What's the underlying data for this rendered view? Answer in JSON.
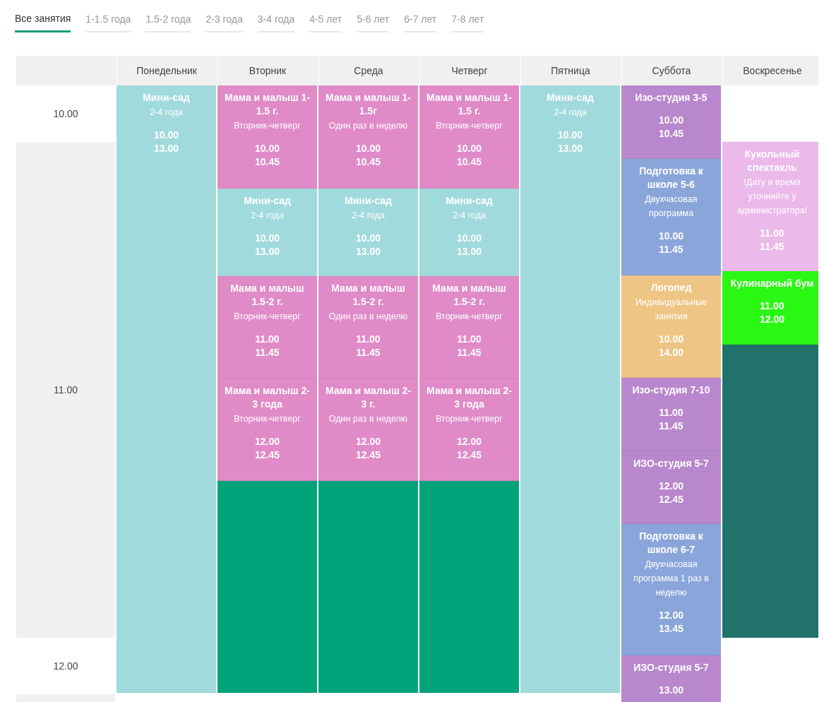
{
  "tabs": [
    {
      "label": "Все занятия",
      "selected": true
    },
    {
      "label": "1-1.5 года",
      "selected": false
    },
    {
      "label": "1.5-2 года",
      "selected": false
    },
    {
      "label": "2-3 года",
      "selected": false
    },
    {
      "label": "3-4 года",
      "selected": false
    },
    {
      "label": "4-5 лет",
      "selected": false
    },
    {
      "label": "5-6 лет",
      "selected": false
    },
    {
      "label": "6-7 лет",
      "selected": false
    },
    {
      "label": "7-8 лет",
      "selected": false
    }
  ],
  "schedule": {
    "time_slots": [
      "10.00",
      "11.00",
      "12.00"
    ],
    "days": [
      {
        "name": "Понедельник",
        "events": [
          {
            "kind": "class",
            "title": "Мини-сад",
            "subtitle": "2-4 года",
            "times": [
              "10.00",
              "13.00"
            ],
            "color": "#a1dadc"
          }
        ]
      },
      {
        "name": "Вторник",
        "events": [
          {
            "kind": "class",
            "title": "Мама и малыш 1-1.5 г.",
            "subtitle": "Вторник-четверг",
            "times": [
              "10.00",
              "10.45"
            ],
            "color": "#e08ac8"
          },
          {
            "kind": "class",
            "title": "Мини-сад",
            "subtitle": "2-4 года",
            "times": [
              "10.00",
              "13.00"
            ],
            "color": "#a1dadc"
          },
          {
            "kind": "class",
            "title": "Мама и малыш 1.5-2 г.",
            "subtitle": "Вторник-четверг",
            "times": [
              "11.00",
              "11.45"
            ],
            "color": "#e08ac8"
          },
          {
            "kind": "class",
            "title": "Мама и малыш 2-3 года",
            "subtitle": "Вторник-четверг",
            "times": [
              "12.00",
              "12.45"
            ],
            "color": "#e08ac8"
          },
          {
            "kind": "filler",
            "color": "#00a37a"
          }
        ]
      },
      {
        "name": "Среда",
        "events": [
          {
            "kind": "class",
            "title": "Мама и малыш 1-1.5г",
            "subtitle": "Один раз в неделю",
            "times": [
              "10.00",
              "10.45"
            ],
            "color": "#e08ac8"
          },
          {
            "kind": "class",
            "title": "Мини-сад",
            "subtitle": "2-4 года",
            "times": [
              "10.00",
              "13.00"
            ],
            "color": "#a1dadc"
          },
          {
            "kind": "class",
            "title": "Мама и малыш 1.5-2 г.",
            "subtitle": "Один раз в неделю",
            "times": [
              "11.00",
              "11.45"
            ],
            "color": "#e08ac8"
          },
          {
            "kind": "class",
            "title": "Мама и малыш 2-3 г.",
            "subtitle": "Один раз в неделю",
            "times": [
              "12.00",
              "12.45"
            ],
            "color": "#e08ac8"
          },
          {
            "kind": "filler",
            "color": "#00a37a"
          }
        ]
      },
      {
        "name": "Четверг",
        "events": [
          {
            "kind": "class",
            "title": "Мама и малыш 1-1.5 г.",
            "subtitle": "Вторник-четверг",
            "times": [
              "10.00",
              "10.45"
            ],
            "color": "#e08ac8"
          },
          {
            "kind": "class",
            "title": "Мини-сад",
            "subtitle": "2-4 года",
            "times": [
              "10.00",
              "13.00"
            ],
            "color": "#a1dadc"
          },
          {
            "kind": "class",
            "title": "Мама и малыш 1.5-2 г.",
            "subtitle": "Вторник-четверг",
            "times": [
              "11.00",
              "11.45"
            ],
            "color": "#e08ac8"
          },
          {
            "kind": "class",
            "title": "Мама и малыш 2-3 года",
            "subtitle": "Вторник-четверг",
            "times": [
              "12.00",
              "12.45"
            ],
            "color": "#e08ac8"
          },
          {
            "kind": "filler",
            "color": "#00a37a"
          }
        ]
      },
      {
        "name": "Пятница",
        "events": [
          {
            "kind": "class",
            "title": "Мини-сад",
            "subtitle": "2-4 года",
            "times": [
              "10.00",
              "13.00"
            ],
            "color": "#a1dadc"
          }
        ]
      },
      {
        "name": "Суббота",
        "events": [
          {
            "kind": "class",
            "title": "Изо-студия 3-5",
            "times": [
              "10.00",
              "10.45"
            ],
            "color": "#b987cd"
          },
          {
            "kind": "class",
            "title": "Подготовка к школе 5-6",
            "subtitle": "Двухчасовая программа",
            "times": [
              "10.00",
              "11.45"
            ],
            "color": "#8aa5da"
          },
          {
            "kind": "class",
            "title": "Логопед",
            "subtitle": "Индивидуальные занятия",
            "times": [
              "10.00",
              "14.00"
            ],
            "color": "#eec584"
          },
          {
            "kind": "class",
            "title": "Изо-студия 7-10",
            "times": [
              "11.00",
              "11.45"
            ],
            "color": "#b987cd"
          },
          {
            "kind": "class",
            "title": "ИЗО-студия 5-7",
            "times": [
              "12.00",
              "12.45"
            ],
            "color": "#b987cd"
          },
          {
            "kind": "class",
            "title": "Подготовка к школе 6-7",
            "subtitle": "Двухчасовая программа 1 раз в неделю",
            "times": [
              "12.00",
              "13.45"
            ],
            "color": "#8aa5da"
          },
          {
            "kind": "class",
            "title": "ИЗО-студия 5-7",
            "times": [
              "13.00"
            ],
            "color": "#b987cd"
          }
        ]
      },
      {
        "name": "Воскресенье",
        "events": [
          {
            "kind": "gap"
          },
          {
            "kind": "class",
            "title": "Кукольный спектакль",
            "subtitle": "!Дату и время уточняйте у администратора!",
            "times": [
              "11.00",
              "11.45"
            ],
            "color": "#ebb9ea"
          },
          {
            "kind": "class",
            "title": "Кулинарный бум",
            "times": [
              "11.00",
              "12.00"
            ],
            "color": "#2bf714"
          },
          {
            "kind": "filler",
            "color": "#20726a"
          }
        ]
      }
    ]
  }
}
